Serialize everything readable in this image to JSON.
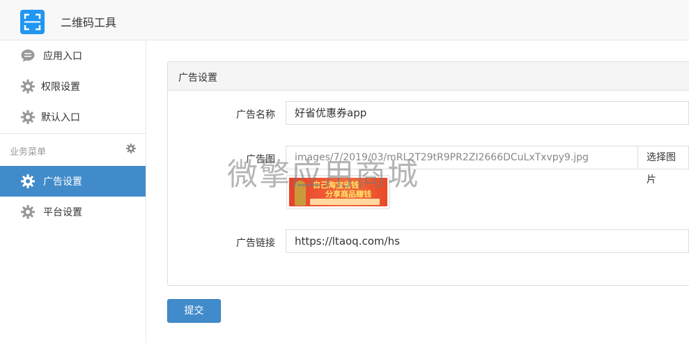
{
  "header": {
    "app_title": "二维码工具"
  },
  "sidebar": {
    "items": [
      {
        "label": "应用入口",
        "icon": "chat-bubble-icon"
      },
      {
        "label": "权限设置",
        "icon": "gear-icon"
      },
      {
        "label": "默认入口",
        "icon": "gear-icon"
      }
    ],
    "section_title": "业务菜单",
    "business_items": [
      {
        "label": "广告设置",
        "icon": "gear-icon",
        "active": true
      },
      {
        "label": "平台设置",
        "icon": "gear-icon",
        "active": false
      }
    ]
  },
  "panel": {
    "heading": "广告设置",
    "ad_name": {
      "label": "广告名称",
      "value": "好省优惠券app"
    },
    "ad_image": {
      "label": "广告图",
      "value": "images/7/2019/03/mRL2T29tR9PR2ZI2666DCuLxTxvpy9.jpg",
      "button": "选择图片",
      "thumb_line1": "自己淘宝省钱",
      "thumb_line2": "分享商品赚钱"
    },
    "ad_link": {
      "label": "广告链接",
      "value": "https://ltaoq.com/hs"
    }
  },
  "submit_label": "提交",
  "watermark": "微擎应用商城",
  "colors": {
    "primary": "#428bca",
    "header_bg": "#f8f8f8",
    "border": "#dddddd"
  }
}
